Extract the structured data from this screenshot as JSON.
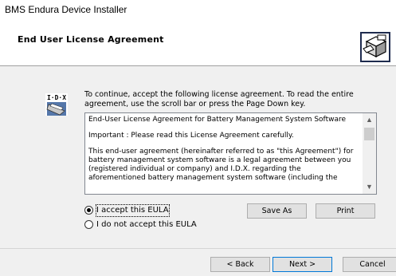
{
  "window": {
    "title": "BMS Endura Device Installer"
  },
  "header": {
    "title": "End User License Agreement",
    "logo_icon": "installer-box-icon"
  },
  "content": {
    "book_icon": "license-book-icon",
    "intro": "To continue, accept the following license agreement. To read the entire agreement, use the scroll bar or press the Page Down key.",
    "eula": {
      "paragraphs": [
        "End-User License Agreement for Battery Management System Software",
        "Important : Please read this License Agreement carefully.",
        "This end-user agreement (hereinafter referred to as \"this Agreement\") for battery management system software is a legal agreement between you (registered individual or company) and I.D.X. regarding the aforementioned battery management system software (including the"
      ]
    },
    "radios": [
      {
        "label": "I accept this EULA",
        "selected": true
      },
      {
        "label": "I do not accept this EULA",
        "selected": false
      }
    ],
    "buttons": {
      "save_as": "Save As",
      "print": "Print"
    }
  },
  "footer": {
    "back": "< Back",
    "next": "Next >",
    "cancel": "Cancel"
  },
  "colors": {
    "accent": "#0078d7",
    "background": "#f0f0f0"
  }
}
